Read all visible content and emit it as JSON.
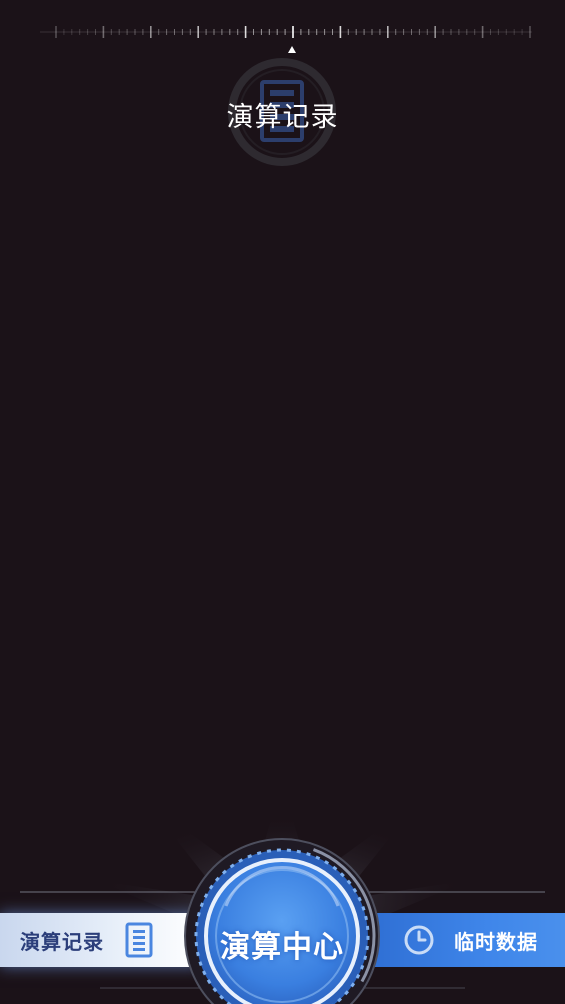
{
  "header": {
    "title": "演算记录"
  },
  "nav": {
    "left_tab_label": "演算记录",
    "center_label": "演算中心",
    "right_tab_label": "临时数据"
  },
  "icons": {
    "emblem": "document-list-icon",
    "left_tab": "document-list-icon",
    "right_tab": "clock-icon"
  },
  "colors": {
    "background": "#1b1218",
    "accent_blue": "#3f86ea",
    "label_dark": "#2b3e7a"
  }
}
